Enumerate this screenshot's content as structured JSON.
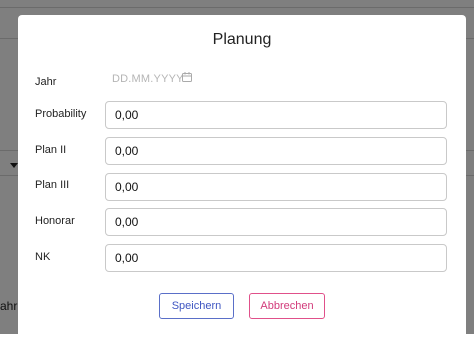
{
  "background": {
    "partial_text": "ahr"
  },
  "dialog": {
    "title": "Planung",
    "date_field": {
      "label": "Jahr",
      "placeholder": "DD.MM.YYYY"
    },
    "fields": [
      {
        "label": "Probability",
        "value": "0,00"
      },
      {
        "label": "Plan II",
        "value": "0,00"
      },
      {
        "label": "Plan III",
        "value": "0,00"
      },
      {
        "label": "Honorar",
        "value": "0,00"
      },
      {
        "label": "NK",
        "value": "0,00"
      }
    ],
    "buttons": {
      "save": "Speichern",
      "cancel": "Abbrechen"
    }
  },
  "colors": {
    "save_accent": "#3f56c2",
    "cancel_accent": "#d23b7b"
  },
  "icons": [
    "calendar-icon",
    "chevron-down-icon"
  ]
}
